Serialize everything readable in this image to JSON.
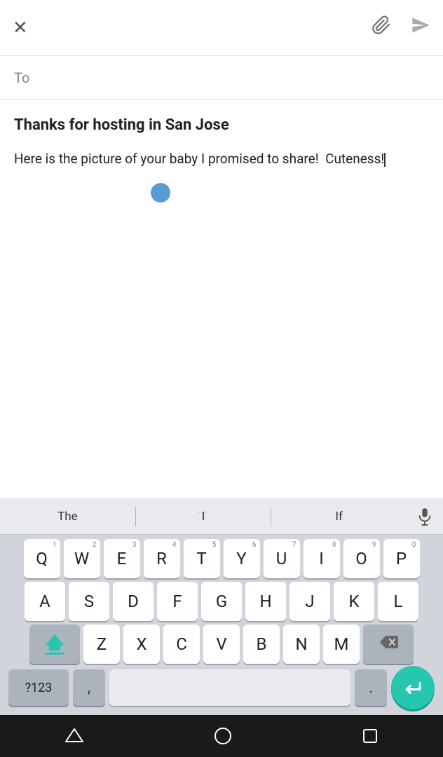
{
  "header": {
    "close_label": "×",
    "attach_label": "📎",
    "send_label": "▶"
  },
  "to_field": {
    "label": "To"
  },
  "email": {
    "subject": "Thanks for hosting in San Jose",
    "body_line1": "Here is the picture of your baby I promised to",
    "body_line2": "share!  Cuteness!"
  },
  "autocomplete": {
    "item1": "The",
    "item2": "I",
    "item3": "If"
  },
  "keyboard": {
    "row1": [
      {
        "letter": "Q",
        "num": "1"
      },
      {
        "letter": "W",
        "num": "2"
      },
      {
        "letter": "E",
        "num": "3"
      },
      {
        "letter": "R",
        "num": "4"
      },
      {
        "letter": "T",
        "num": "5"
      },
      {
        "letter": "Y",
        "num": "6"
      },
      {
        "letter": "U",
        "num": "7"
      },
      {
        "letter": "I",
        "num": "8"
      },
      {
        "letter": "O",
        "num": "9"
      },
      {
        "letter": "P",
        "num": "0"
      }
    ],
    "row2": [
      "A",
      "S",
      "D",
      "F",
      "G",
      "H",
      "J",
      "K",
      "L"
    ],
    "row3": [
      "Z",
      "X",
      "C",
      "V",
      "B",
      "N",
      "M"
    ],
    "bottom": {
      "sym_label": "?123",
      "comma": ",",
      "period": "."
    }
  },
  "navbar": {
    "back_label": "▽",
    "home_label": "○",
    "recent_label": "□"
  }
}
